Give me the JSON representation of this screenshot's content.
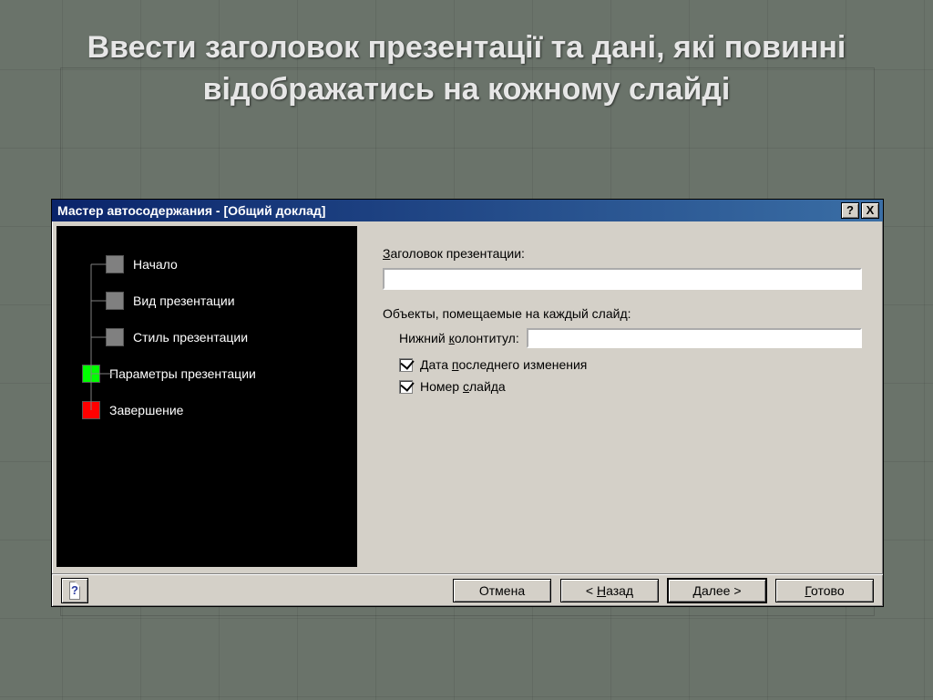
{
  "slide": {
    "title": "Ввести заголовок презентації та дані, які повинні відображатись на кожному слайді"
  },
  "dialog": {
    "title": "Мастер автосодержания - [Общий доклад]",
    "help_glyph": "?",
    "close_glyph": "X"
  },
  "nav": {
    "items": [
      {
        "label": "Начало",
        "color": "gray",
        "indent": 0
      },
      {
        "label": "Вид презентации",
        "color": "gray",
        "indent": 1
      },
      {
        "label": "Стиль презентации",
        "color": "gray",
        "indent": 1
      },
      {
        "label": "Параметры презентации",
        "color": "green",
        "indent": 1
      },
      {
        "label": "Завершение",
        "color": "red",
        "indent": 0
      }
    ]
  },
  "form": {
    "title_label_pre": "З",
    "title_label_rest": "аголовок презентации:",
    "title_value": "",
    "objects_label": "Объекты, помещаемые на каждый слайд:",
    "footer_label_pre": "Нижний ",
    "footer_label_u": "к",
    "footer_label_rest": "олонтитул:",
    "footer_value": "",
    "date_label_pre": "Дата ",
    "date_label_u": "п",
    "date_label_rest": "оследнего изменения",
    "date_checked": true,
    "slidenum_label_pre": "Номер ",
    "slidenum_label_u": "с",
    "slidenum_label_rest": "лайда",
    "slidenum_checked": true
  },
  "buttons": {
    "cancel": "Отмена",
    "back_pre": "< ",
    "back_u": "Н",
    "back_rest": "азад",
    "next_u": "Д",
    "next_rest": "алее >",
    "finish_u": "Г",
    "finish_rest": "отово"
  }
}
